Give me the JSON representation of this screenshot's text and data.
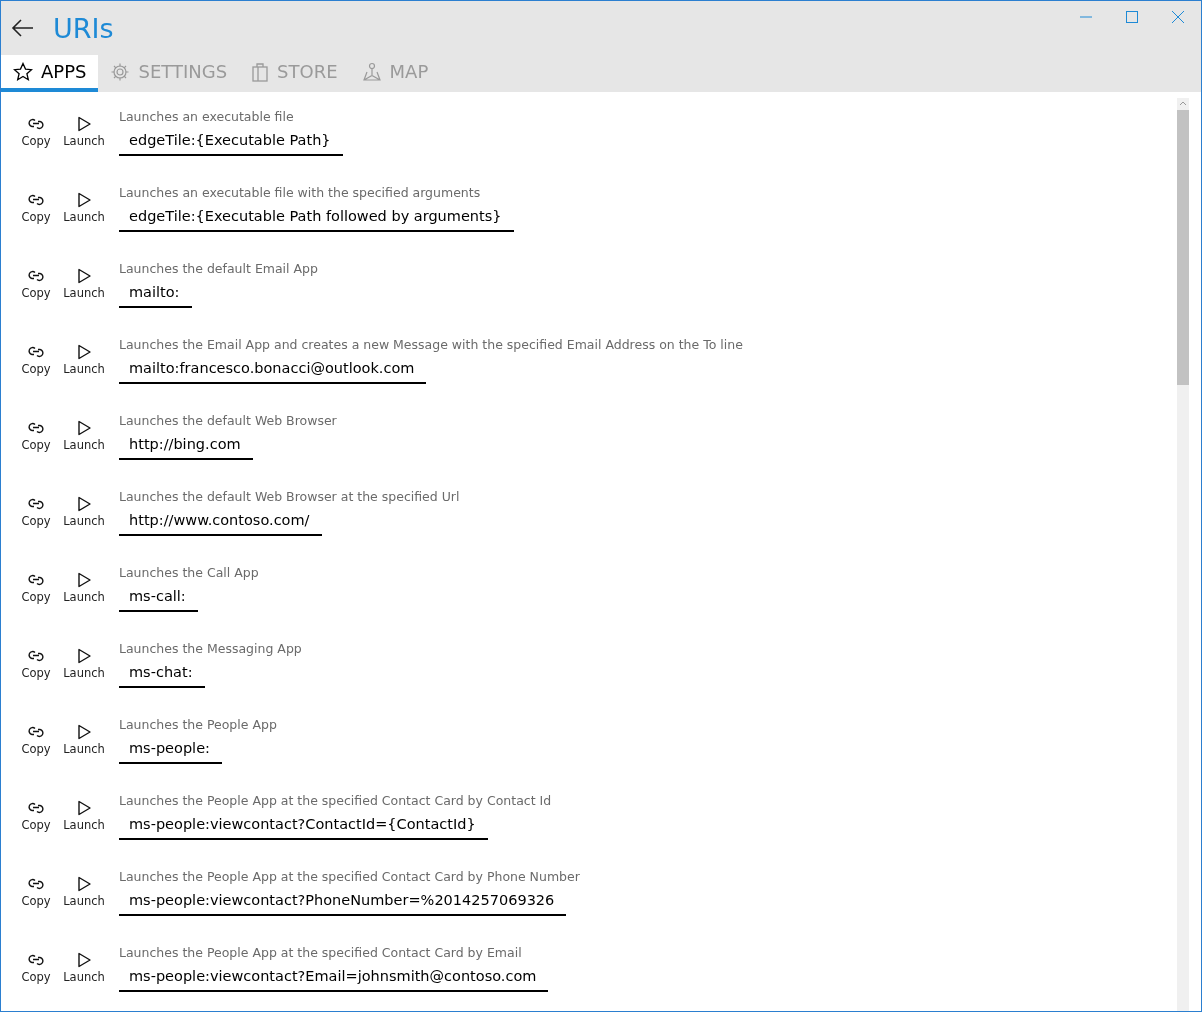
{
  "window": {
    "title": "URIs"
  },
  "tabs": [
    {
      "label": "APPS",
      "selected": true
    },
    {
      "label": "SETTINGS",
      "selected": false
    },
    {
      "label": "STORE",
      "selected": false
    },
    {
      "label": "MAP",
      "selected": false
    }
  ],
  "items": [
    {
      "description": "Launches an executable file",
      "uri": "edgeTile:{Executable Path}",
      "copy": "Copy",
      "launch": "Launch"
    },
    {
      "description": "Launches an executable file with the specified arguments",
      "uri": "edgeTile:{Executable Path followed by arguments}",
      "copy": "Copy",
      "launch": "Launch"
    },
    {
      "description": "Launches the default Email App",
      "uri": "mailto:",
      "copy": "Copy",
      "launch": "Launch"
    },
    {
      "description": "Launches the Email App and creates a new Message with the specified Email Address on the To line",
      "uri": "mailto:francesco.bonacci@outlook.com",
      "copy": "Copy",
      "launch": "Launch"
    },
    {
      "description": "Launches the default Web Browser",
      "uri": "http://bing.com",
      "copy": "Copy",
      "launch": "Launch"
    },
    {
      "description": "Launches the default Web Browser at the specified Url",
      "uri": "http://www.contoso.com/",
      "copy": "Copy",
      "launch": "Launch"
    },
    {
      "description": "Launches the Call App",
      "uri": "ms-call:",
      "copy": "Copy",
      "launch": "Launch"
    },
    {
      "description": "Launches the Messaging App",
      "uri": "ms-chat:",
      "copy": "Copy",
      "launch": "Launch"
    },
    {
      "description": "Launches the People App",
      "uri": "ms-people:",
      "copy": "Copy",
      "launch": "Launch"
    },
    {
      "description": "Launches the People App at the specified Contact Card by Contact Id",
      "uri": "ms-people:viewcontact?ContactId={ContactId}",
      "copy": "Copy",
      "launch": "Launch"
    },
    {
      "description": "Launches the People App at the specified Contact Card by Phone Number",
      "uri": "ms-people:viewcontact?PhoneNumber=%2014257069326",
      "copy": "Copy",
      "launch": "Launch"
    },
    {
      "description": "Launches the People App at the specified Contact Card by Email",
      "uri": "ms-people:viewcontact?Email=johnsmith@contoso.com",
      "copy": "Copy",
      "launch": "Launch"
    }
  ]
}
